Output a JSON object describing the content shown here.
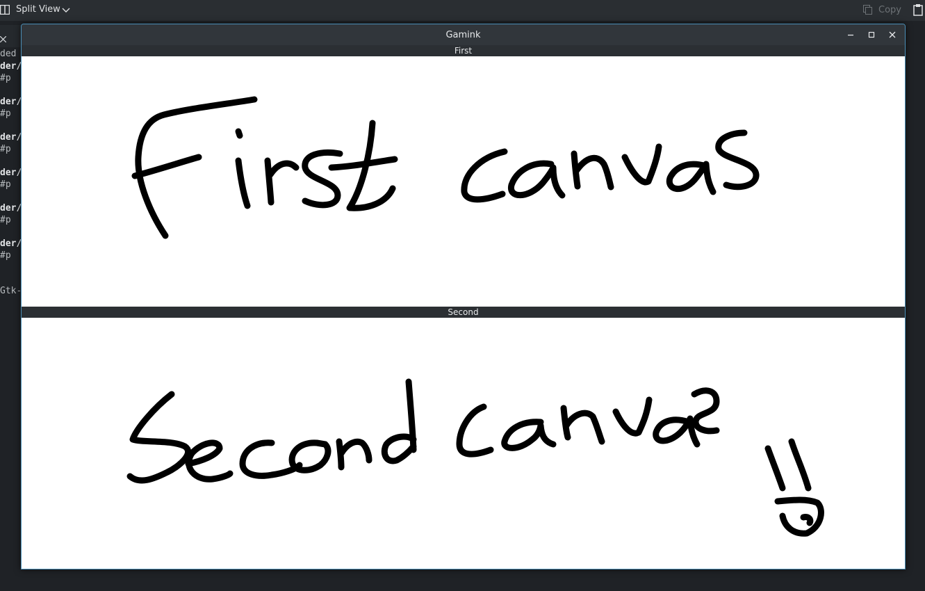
{
  "background_app": {
    "toolbar": {
      "split_view_label": "Split View",
      "split_view_icon": "split-view-icon",
      "copy_label": "Copy",
      "copy_icon": "copy-icon",
      "paste_icon": "paste-icon"
    },
    "terminal_lines": [
      {
        "text": "ded -",
        "bold": false
      },
      {
        "text": "der/C",
        "bold": true
      },
      {
        "text": "  #p",
        "bold": false
      },
      {
        "text": "der/C",
        "bold": true
      },
      {
        "text": "  #p",
        "bold": false
      },
      {
        "text": "der/C",
        "bold": true
      },
      {
        "text": "  #p",
        "bold": false
      },
      {
        "text": "der/C",
        "bold": true
      },
      {
        "text": "  #p",
        "bold": false
      },
      {
        "text": "der/C",
        "bold": true
      },
      {
        "text": "  #p",
        "bold": false
      },
      {
        "text": "der/C",
        "bold": true
      },
      {
        "text": "  #p",
        "bold": false
      },
      {
        "text": "Gtk-",
        "bold": false
      }
    ]
  },
  "window": {
    "title": "Gamink",
    "controls": [
      "minimize-icon",
      "maximize-icon",
      "close-icon"
    ],
    "canvases": [
      {
        "label": "First",
        "handwriting": "First canvas"
      },
      {
        "label": "Second",
        "handwriting": "Second canvas"
      }
    ]
  },
  "colors": {
    "accent_border": "#4b8fb7",
    "canvas_bg": "#ffffff",
    "ink": "#000000"
  }
}
